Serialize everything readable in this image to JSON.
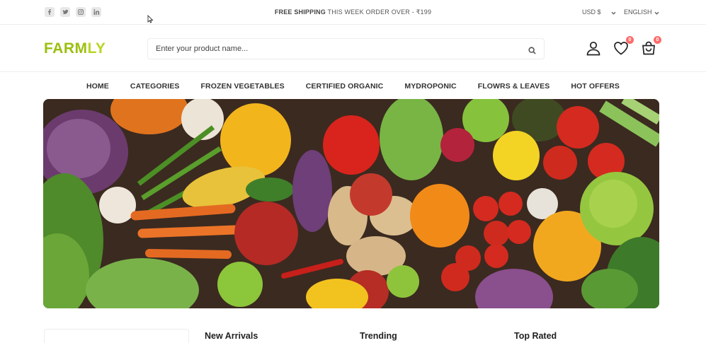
{
  "topbar": {
    "social_icons": [
      "facebook-icon",
      "twitter-icon",
      "instagram-icon",
      "linkedin-icon"
    ],
    "shipping_bold": "FREE SHIPPING",
    "shipping_rest": " THIS WEEK ORDER OVER - ₹199",
    "currency": "USD $",
    "language": "ENGLISH"
  },
  "header": {
    "logo_part1": "FARM",
    "logo_part2": "LY",
    "search_placeholder": "Enter your product name...",
    "wishlist_count": "0",
    "cart_count": "0"
  },
  "nav": {
    "items": [
      "HOME",
      "CATEGORIES",
      "FROZEN VEGETABLES",
      "CERTIFIED ORGANIC",
      "MYDROPONIC",
      "FLOWRS & LEAVES",
      "HOT OFFERS"
    ]
  },
  "sections": {
    "new_arrivals": "New Arrivals",
    "trending": "Trending",
    "top_rated": "Top Rated"
  },
  "colors": {
    "logo_dark_green": "#9bbf0f",
    "logo_light_green": "#b8d523",
    "badge": "#ff6b6b"
  }
}
